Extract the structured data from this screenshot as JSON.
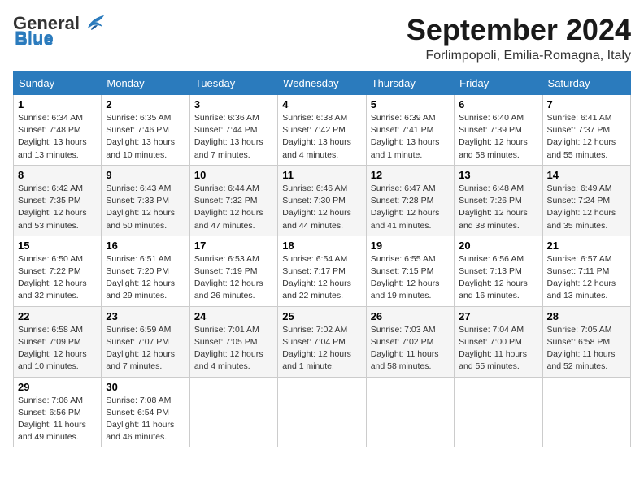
{
  "header": {
    "logo_general": "General",
    "logo_blue": "Blue",
    "month_title": "September 2024",
    "location": "Forlimpopoli, Emilia-Romagna, Italy"
  },
  "days_of_week": [
    "Sunday",
    "Monday",
    "Tuesday",
    "Wednesday",
    "Thursday",
    "Friday",
    "Saturday"
  ],
  "weeks": [
    [
      {
        "day": "1",
        "sunrise": "6:34 AM",
        "sunset": "7:48 PM",
        "daylight": "13 hours and 13 minutes."
      },
      {
        "day": "2",
        "sunrise": "6:35 AM",
        "sunset": "7:46 PM",
        "daylight": "13 hours and 10 minutes."
      },
      {
        "day": "3",
        "sunrise": "6:36 AM",
        "sunset": "7:44 PM",
        "daylight": "13 hours and 7 minutes."
      },
      {
        "day": "4",
        "sunrise": "6:38 AM",
        "sunset": "7:42 PM",
        "daylight": "13 hours and 4 minutes."
      },
      {
        "day": "5",
        "sunrise": "6:39 AM",
        "sunset": "7:41 PM",
        "daylight": "13 hours and 1 minute."
      },
      {
        "day": "6",
        "sunrise": "6:40 AM",
        "sunset": "7:39 PM",
        "daylight": "12 hours and 58 minutes."
      },
      {
        "day": "7",
        "sunrise": "6:41 AM",
        "sunset": "7:37 PM",
        "daylight": "12 hours and 55 minutes."
      }
    ],
    [
      {
        "day": "8",
        "sunrise": "6:42 AM",
        "sunset": "7:35 PM",
        "daylight": "12 hours and 53 minutes."
      },
      {
        "day": "9",
        "sunrise": "6:43 AM",
        "sunset": "7:33 PM",
        "daylight": "12 hours and 50 minutes."
      },
      {
        "day": "10",
        "sunrise": "6:44 AM",
        "sunset": "7:32 PM",
        "daylight": "12 hours and 47 minutes."
      },
      {
        "day": "11",
        "sunrise": "6:46 AM",
        "sunset": "7:30 PM",
        "daylight": "12 hours and 44 minutes."
      },
      {
        "day": "12",
        "sunrise": "6:47 AM",
        "sunset": "7:28 PM",
        "daylight": "12 hours and 41 minutes."
      },
      {
        "day": "13",
        "sunrise": "6:48 AM",
        "sunset": "7:26 PM",
        "daylight": "12 hours and 38 minutes."
      },
      {
        "day": "14",
        "sunrise": "6:49 AM",
        "sunset": "7:24 PM",
        "daylight": "12 hours and 35 minutes."
      }
    ],
    [
      {
        "day": "15",
        "sunrise": "6:50 AM",
        "sunset": "7:22 PM",
        "daylight": "12 hours and 32 minutes."
      },
      {
        "day": "16",
        "sunrise": "6:51 AM",
        "sunset": "7:20 PM",
        "daylight": "12 hours and 29 minutes."
      },
      {
        "day": "17",
        "sunrise": "6:53 AM",
        "sunset": "7:19 PM",
        "daylight": "12 hours and 26 minutes."
      },
      {
        "day": "18",
        "sunrise": "6:54 AM",
        "sunset": "7:17 PM",
        "daylight": "12 hours and 22 minutes."
      },
      {
        "day": "19",
        "sunrise": "6:55 AM",
        "sunset": "7:15 PM",
        "daylight": "12 hours and 19 minutes."
      },
      {
        "day": "20",
        "sunrise": "6:56 AM",
        "sunset": "7:13 PM",
        "daylight": "12 hours and 16 minutes."
      },
      {
        "day": "21",
        "sunrise": "6:57 AM",
        "sunset": "7:11 PM",
        "daylight": "12 hours and 13 minutes."
      }
    ],
    [
      {
        "day": "22",
        "sunrise": "6:58 AM",
        "sunset": "7:09 PM",
        "daylight": "12 hours and 10 minutes."
      },
      {
        "day": "23",
        "sunrise": "6:59 AM",
        "sunset": "7:07 PM",
        "daylight": "12 hours and 7 minutes."
      },
      {
        "day": "24",
        "sunrise": "7:01 AM",
        "sunset": "7:05 PM",
        "daylight": "12 hours and 4 minutes."
      },
      {
        "day": "25",
        "sunrise": "7:02 AM",
        "sunset": "7:04 PM",
        "daylight": "12 hours and 1 minute."
      },
      {
        "day": "26",
        "sunrise": "7:03 AM",
        "sunset": "7:02 PM",
        "daylight": "11 hours and 58 minutes."
      },
      {
        "day": "27",
        "sunrise": "7:04 AM",
        "sunset": "7:00 PM",
        "daylight": "11 hours and 55 minutes."
      },
      {
        "day": "28",
        "sunrise": "7:05 AM",
        "sunset": "6:58 PM",
        "daylight": "11 hours and 52 minutes."
      }
    ],
    [
      {
        "day": "29",
        "sunrise": "7:06 AM",
        "sunset": "6:56 PM",
        "daylight": "11 hours and 49 minutes."
      },
      {
        "day": "30",
        "sunrise": "7:08 AM",
        "sunset": "6:54 PM",
        "daylight": "11 hours and 46 minutes."
      },
      null,
      null,
      null,
      null,
      null
    ]
  ]
}
